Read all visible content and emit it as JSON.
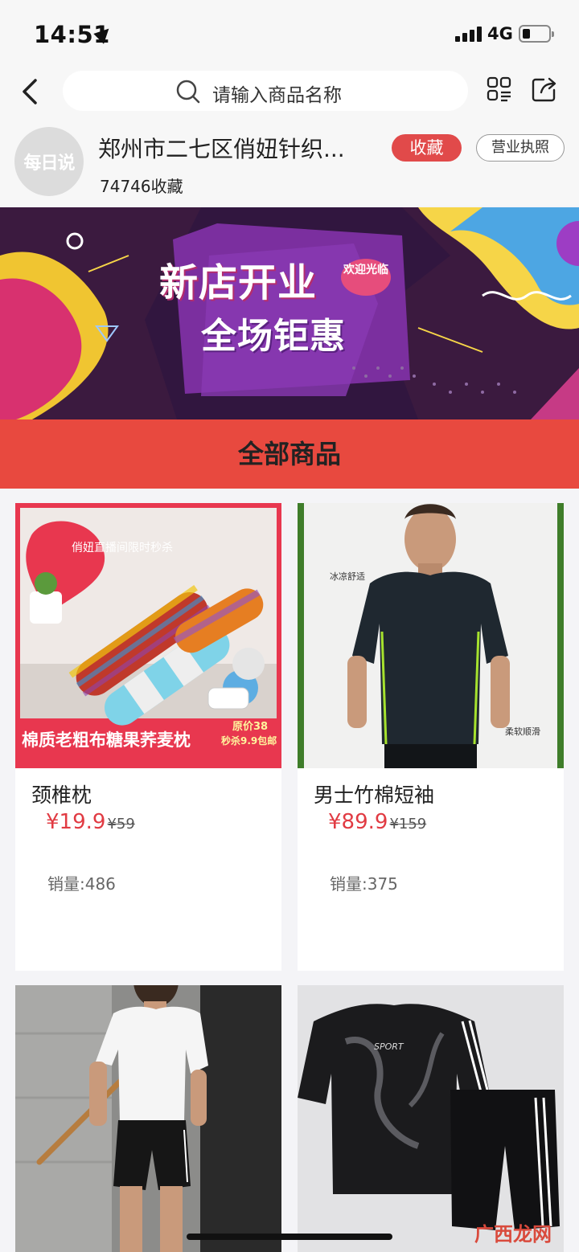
{
  "status_bar": {
    "time": "14:51",
    "network": "4G"
  },
  "nav": {
    "search_placeholder": "请输入商品名称"
  },
  "shop": {
    "avatar_text": "每日说",
    "name": "郑州市二七区俏妞针织...",
    "favorites": "74746收藏",
    "favorite_button": "收藏",
    "license_button": "营业执照"
  },
  "banner": {
    "line1": "新店开业",
    "line2": "全场钜惠",
    "badge": "欢迎光临"
  },
  "section_title": "全部商品",
  "products": [
    {
      "name": "颈椎枕",
      "price": "¥19.9",
      "original_price": "¥59",
      "sales": "销量:486",
      "image_text": {
        "tag": "俏妞直播间限时秒杀",
        "caption": "棉质老粗布糖果荞麦枕",
        "promo1": "原价38",
        "promo2": "秒杀9.9包邮"
      }
    },
    {
      "name": "男士竹棉短袖",
      "price": "¥89.9",
      "original_price": "¥159",
      "sales": "销量:375",
      "image_text": {
        "note1": "冰凉舒适",
        "note2": "柔软顺滑"
      }
    },
    {
      "name": "",
      "price": "",
      "original_price": "",
      "sales": ""
    },
    {
      "name": "",
      "price": "",
      "original_price": "",
      "sales": ""
    }
  ],
  "watermark": "广西龙网",
  "colors": {
    "accent": "#e14a4a",
    "section_bg": "#e8493f",
    "price": "#e13b43"
  }
}
